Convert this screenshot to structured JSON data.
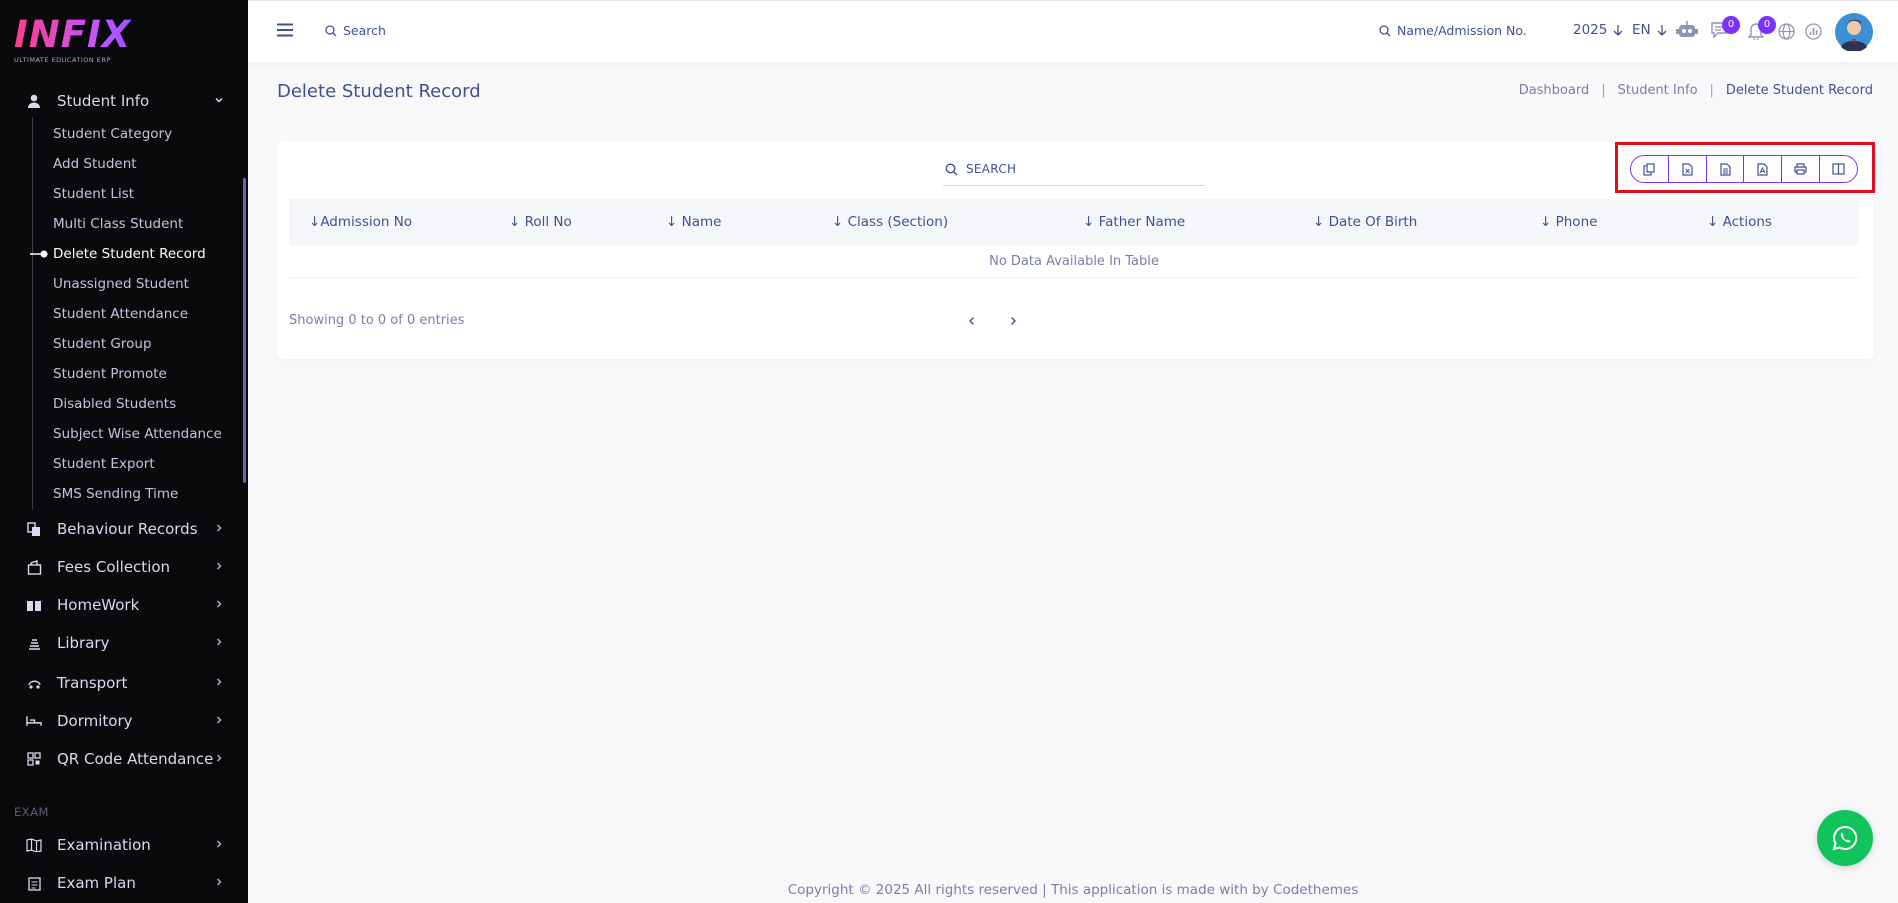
{
  "brand": {
    "logo_text": "INFIX",
    "tagline": "ULTIMATE EDUCATION ERP"
  },
  "sidebar": {
    "student_info": {
      "label": "Student Info"
    },
    "sub_items": [
      "Student Category",
      "Add Student",
      "Student List",
      "Multi Class Student",
      "Delete Student Record",
      "Unassigned Student",
      "Student Attendance",
      "Student Group",
      "Student Promote",
      "Disabled Students",
      "Subject Wise Attendance",
      "Student Export",
      "SMS Sending Time"
    ],
    "active_sub_item": "Delete Student Record",
    "menus": [
      {
        "label": "Behaviour Records",
        "icon": "behaviour-icon"
      },
      {
        "label": "Fees Collection",
        "icon": "fees-icon"
      },
      {
        "label": "HomeWork",
        "icon": "book-icon"
      },
      {
        "label": "Library",
        "icon": "library-icon"
      },
      {
        "label": "Transport",
        "icon": "transport-icon"
      },
      {
        "label": "Dormitory",
        "icon": "bed-icon"
      },
      {
        "label": "QR Code Attendance",
        "icon": "qr-icon"
      }
    ],
    "section_exam": "EXAM",
    "exam_menus": [
      {
        "label": "Examination",
        "icon": "map-icon"
      },
      {
        "label": "Exam Plan",
        "icon": "clipboard-icon"
      }
    ]
  },
  "topbar": {
    "search_placeholder": "Search",
    "student_search_placeholder": "Name/Admission No.",
    "year": "2025",
    "language": "EN",
    "messages_count": "0",
    "notifications_count": "0"
  },
  "page": {
    "title": "Delete Student Record",
    "breadcrumb": [
      "Dashboard",
      "Student Info",
      "Delete Student Record"
    ]
  },
  "table": {
    "search_label": "SEARCH",
    "export_buttons": [
      "copy-icon",
      "excel-icon",
      "csv-icon",
      "pdf-icon",
      "print-icon",
      "columns-icon"
    ],
    "columns": [
      "Admission No",
      "Roll No",
      "Name",
      "Class (Section)",
      "Father Name",
      "Date Of Birth",
      "Phone",
      "Actions"
    ],
    "empty_message": "No Data Available In Table",
    "showing": "Showing 0 to 0 of 0 entries"
  },
  "footer": {
    "text": "Copyright © 2025 All rights reserved | This application is made with by Codethemes"
  },
  "colors": {
    "accent": "#7c32ff",
    "sidebar_bg": "#0a0a0d",
    "highlight": "#e10d1c",
    "whatsapp": "#10c35a"
  }
}
